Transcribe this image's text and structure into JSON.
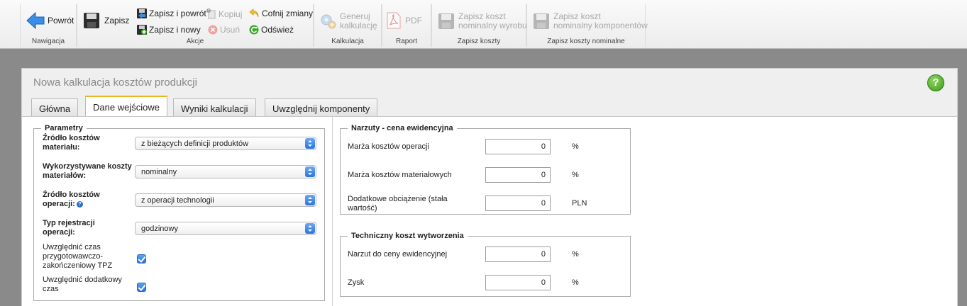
{
  "toolbar": {
    "groups": {
      "nav": "Nawigacja",
      "actions": "Akcje",
      "calc": "Kalkulacja",
      "report": "Raport",
      "save_costs": "Zapisz koszty",
      "save_nominal": "Zapisz koszty nominalne"
    },
    "back": "Powrót",
    "save": "Zapisz",
    "save_return": "Zapisz i powrót",
    "save_new": "Zapisz i nowy",
    "copy": "Kopiuj",
    "delete": "Usuń",
    "undo": "Cofnij zmiany",
    "refresh": "Odśwież",
    "generate_line1": "Generuj",
    "generate_line2": "kalkulację",
    "pdf": "PDF",
    "save_nominal_product_line1": "Zapisz koszt",
    "save_nominal_product_line2": "nominalny wyrobu",
    "save_nominal_components_line1": "Zapisz koszt",
    "save_nominal_components_line2": "nominalny komponentów"
  },
  "panel": {
    "title": "Nowa kalkulacja kosztów produkcji",
    "help": "?",
    "tabs": [
      "Główna",
      "Dane wejściowe",
      "Wyniki kalkulacji",
      "Uwzględnij komponenty"
    ]
  },
  "params": {
    "legend": "Parametry",
    "material_source_label": "Źródło kosztów materiału:",
    "material_source_value": "z bieżących definicji produktów",
    "material_costs_label": "Wykorzystywane koszty materiałów:",
    "material_costs_value": "nominalny",
    "operation_source_label": "Źródło kosztów operacji:",
    "operation_source_value": "z operacji technologii",
    "registration_type_label": "Typ rejestracji operacji:",
    "registration_type_value": "godzinowy",
    "tpz_label": "Uwzględnić czas przygotowawczo-zakończeniowy TPZ",
    "tpz_checked": true,
    "extra_time_label": "Uwzględnić dodatkowy czas",
    "extra_time_checked": true
  },
  "surcharges": {
    "legend": "Narzuty - cena ewidencyjna",
    "rows": [
      {
        "label": "Marża kosztów operacji",
        "value": "0",
        "unit": "%"
      },
      {
        "label": "Marża kosztów materiałowych",
        "value": "0",
        "unit": "%"
      },
      {
        "label": "Dodatkowe obciążenie (stała wartość)",
        "value": "0",
        "unit": "PLN"
      }
    ]
  },
  "technical": {
    "legend": "Techniczny koszt wytworzenia",
    "rows": [
      {
        "label": "Narzut do ceny ewidencyjnej",
        "value": "0",
        "unit": "%"
      },
      {
        "label": "Zysk",
        "value": "0",
        "unit": "%"
      }
    ]
  }
}
